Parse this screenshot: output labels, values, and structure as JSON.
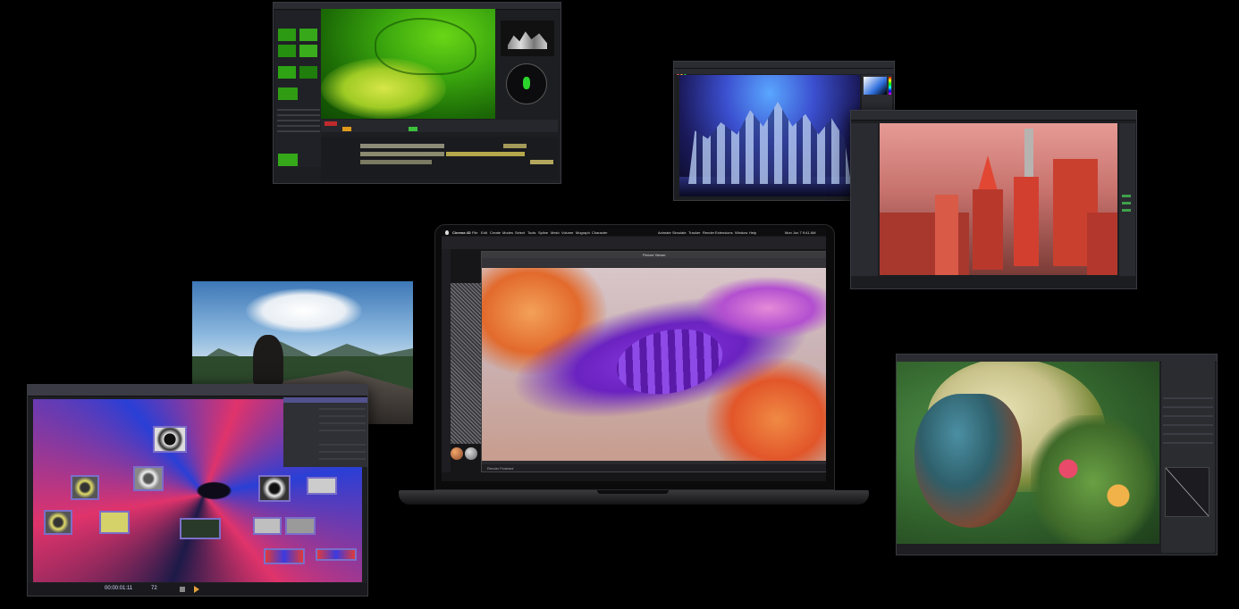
{
  "scene": {
    "colors": {
      "background": "#000000",
      "green_screen": "#2fb30f",
      "render_purple": "#7a2fd0",
      "render_orange": "#e26a2c",
      "touch_pink": "#e0336b",
      "touch_blue": "#2a3fd6",
      "city_red": "#c93b2e",
      "portrait_green": "#3f7a3a"
    }
  },
  "laptop": {
    "menu": [
      "Cinema 4D",
      "File",
      "Edit",
      "Create",
      "Modes",
      "Select",
      "Tools",
      "Spline",
      "Mesh",
      "Volume",
      "Mograph",
      "Character",
      "Animate",
      "Simulate",
      "Tracker",
      "Render",
      "Extensions",
      "Window",
      "Help"
    ],
    "clock": "Mon Jun 7 9:41 AM",
    "viewer_title": "Picture Viewer",
    "status": "Render Finished"
  },
  "touchdesigner": {
    "timecode": "00:00:01:11",
    "frame": "72"
  },
  "icons": [
    "play-icon",
    "stop-icon",
    "apple-logo-icon"
  ]
}
